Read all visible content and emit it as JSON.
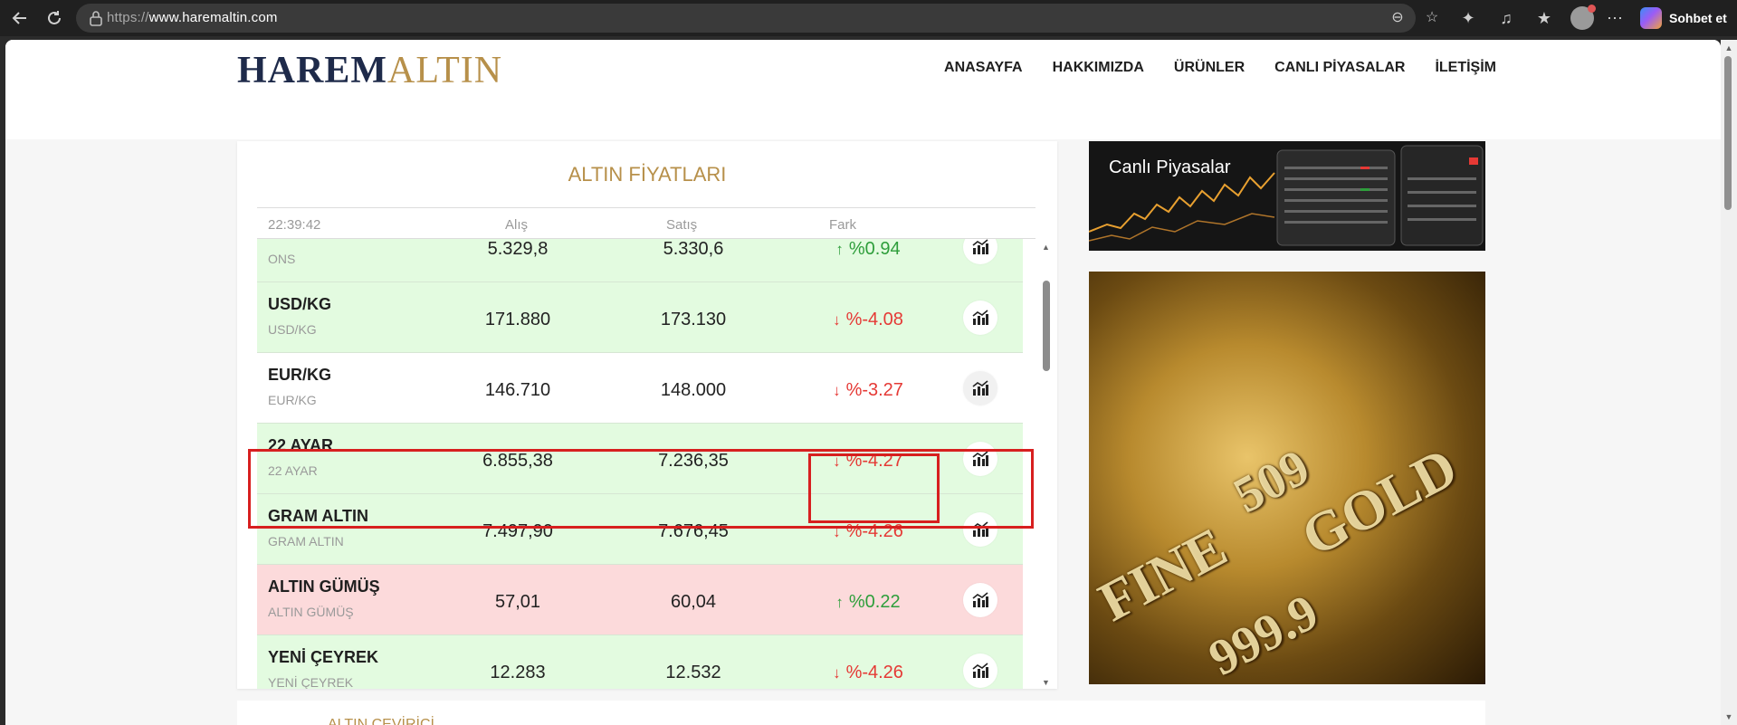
{
  "browser": {
    "url_prefix": "https://",
    "url_host": "www.haremaltin.com",
    "copilot_label": "Sohbet et"
  },
  "header": {
    "brand_part1": "HAREM",
    "brand_part2": "ALTIN",
    "menu": [
      "ANASAYFA",
      "HAKKIMIZDA",
      "ÜRÜNLER",
      "CANLI PİYASALAR",
      "İLETİŞİM"
    ]
  },
  "gold_table": {
    "title": "ALTIN FİYATLARI",
    "time": "22:39:42",
    "col_alis": "Alış",
    "col_satis": "Satış",
    "col_fark": "Fark",
    "rows": [
      {
        "name": "",
        "sub": "ONS",
        "alis": "5.329,8",
        "satis": "5.330,6",
        "fark": "%0.94",
        "dir": "up"
      },
      {
        "name": "USD/KG",
        "sub": "USD/KG",
        "alis": "171.880",
        "satis": "173.130",
        "fark": "%-4.08",
        "dir": "down"
      },
      {
        "name": "EUR/KG",
        "sub": "EUR/KG",
        "alis": "146.710",
        "satis": "148.000",
        "fark": "%-3.27",
        "dir": "down"
      },
      {
        "name": "22 AYAR",
        "sub": "22 AYAR",
        "alis": "6.855,38",
        "satis": "7.236,35",
        "fark": "%-4.27",
        "dir": "down"
      },
      {
        "name": "GRAM ALTIN",
        "sub": "GRAM ALTIN",
        "alis": "7.497,90",
        "satis": "7.676,45",
        "fark": "%-4.26",
        "dir": "down"
      },
      {
        "name": "ALTIN GÜMÜŞ",
        "sub": "ALTIN GÜMÜŞ",
        "alis": "57,01",
        "satis": "60,04",
        "fark": "%0.22",
        "dir": "up"
      },
      {
        "name": "YENİ ÇEYREK",
        "sub": "YENİ ÇEYREK",
        "alis": "12.283",
        "satis": "12.532",
        "fark": "%-4.26",
        "dir": "down"
      }
    ]
  },
  "sidebar": {
    "canli_title": "Canlı Piyasalar",
    "gold_engraving": [
      "FINE",
      "GOLD",
      "999.9",
      "509"
    ]
  },
  "bottom": {
    "section_title": "ALTIN ÇEVİRİCİ"
  },
  "colors": {
    "brand_navy": "#1e2a4a",
    "brand_gold": "#b7904a",
    "row_green": "#e3fbe0",
    "row_red": "#fcdadb",
    "down_red": "#e53935",
    "up_green": "#2e9e3b",
    "highlight": "#d71f1f"
  }
}
